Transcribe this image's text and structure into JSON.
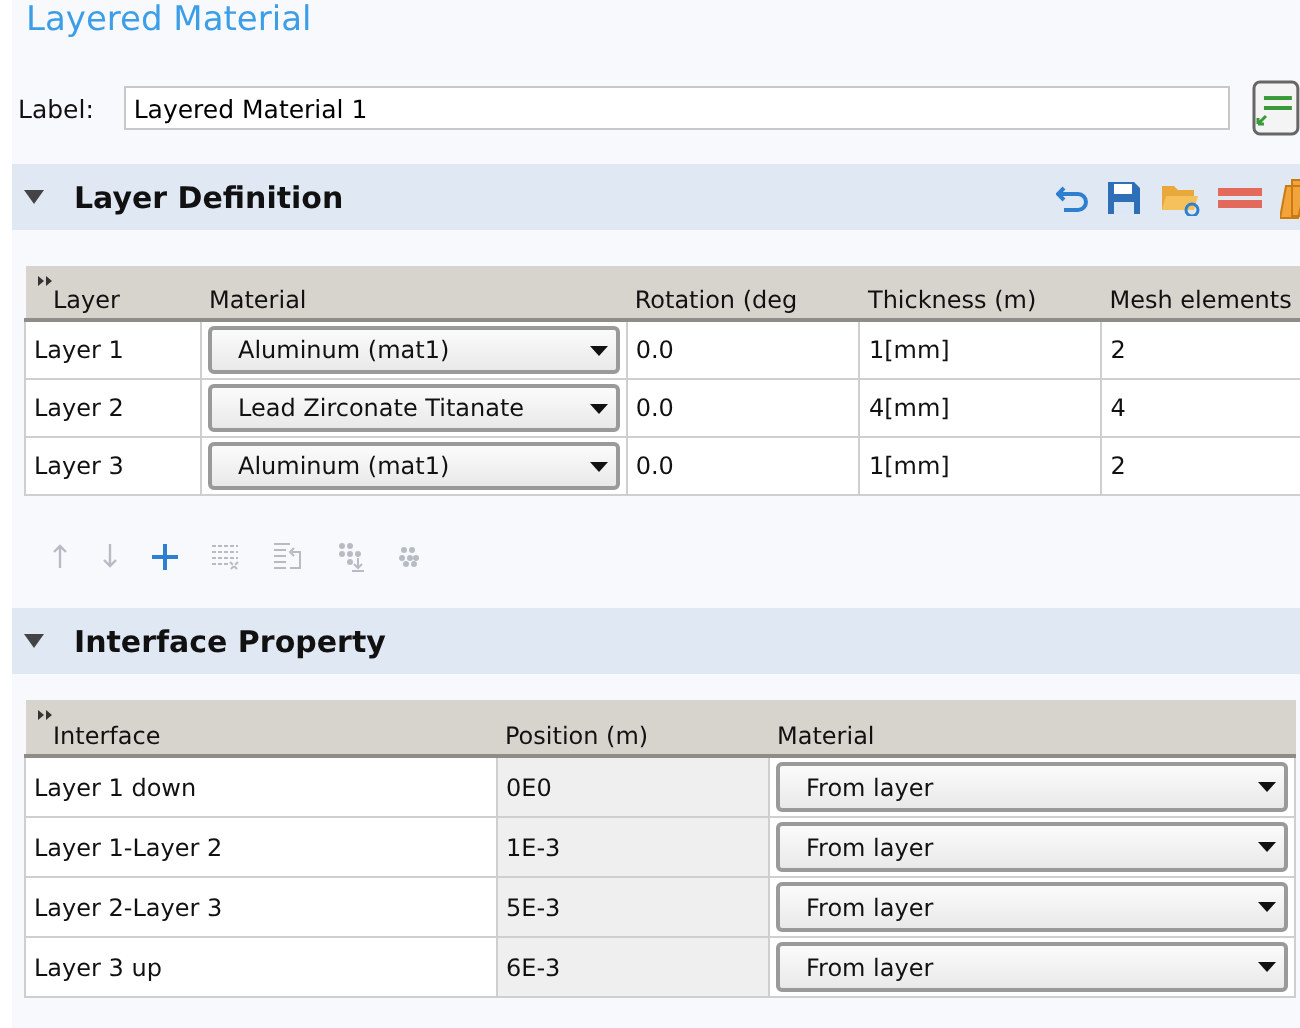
{
  "title": "Layered Material",
  "label_field": {
    "label": "Label:",
    "value": "Layered Material 1"
  },
  "layer_section": {
    "title": "Layer Definition",
    "expanded": true,
    "columns": [
      "Layer",
      "Material",
      "Rotation (deg",
      "Thickness (m)",
      "Mesh elements"
    ],
    "rows": [
      {
        "layer": "Layer 1",
        "material": "Aluminum (mat1)",
        "rotation": "0.0",
        "thickness": "1[mm]",
        "mesh": "2"
      },
      {
        "layer": "Layer 2",
        "material": "Lead Zirconate Titanate",
        "rotation": "0.0",
        "thickness": "4[mm]",
        "mesh": "4"
      },
      {
        "layer": "Layer 3",
        "material": "Aluminum (mat1)",
        "rotation": "0.0",
        "thickness": "1[mm]",
        "mesh": "2"
      }
    ],
    "toolbar": [
      {
        "kind": "up",
        "disabled": true
      },
      {
        "kind": "down",
        "disabled": true
      },
      {
        "kind": "add",
        "disabled": false
      },
      {
        "kind": "clear",
        "disabled": true
      },
      {
        "kind": "load",
        "disabled": true
      },
      {
        "kind": "grid-down",
        "disabled": true
      },
      {
        "kind": "grid",
        "disabled": true
      }
    ]
  },
  "interface_section": {
    "title": "Interface Property",
    "expanded": true,
    "columns": [
      "Interface",
      "Position (m)",
      "Material"
    ],
    "rows": [
      {
        "interface": "Layer 1 down",
        "position": "0E0",
        "material": "From layer"
      },
      {
        "interface": "Layer 1-Layer 2",
        "position": "1E-3",
        "material": "From layer"
      },
      {
        "interface": "Layer 2-Layer 3",
        "position": "5E-3",
        "material": "From layer"
      },
      {
        "interface": "Layer 3 up",
        "position": "6E-3",
        "material": "From layer"
      }
    ]
  }
}
